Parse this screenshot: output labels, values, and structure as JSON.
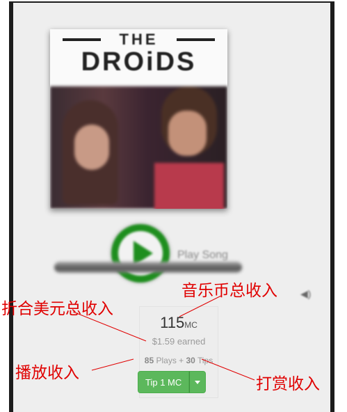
{
  "album": {
    "logo_the": "THE",
    "logo_name": "DROiDS"
  },
  "player": {
    "play_label": "Play Song"
  },
  "stats": {
    "coins": "115",
    "coins_unit": "MC",
    "earned": "$1.59 earned",
    "plays_count": "85",
    "plays_label": " Plays + ",
    "tips_count": "30",
    "tips_label": " Tips"
  },
  "tip": {
    "button_label": "Tip 1 MC"
  },
  "annotations": {
    "coins_total": "音乐币总收入",
    "usd_total": "折合美元总收入",
    "play_income": "播放收入",
    "tip_income": "打赏收入"
  },
  "colors": {
    "annotation": "#e00000",
    "tip_button": "#5cb85c",
    "play_button": "#1e8e1e"
  },
  "icons": [
    "play-icon",
    "volume-icon",
    "caret-down-icon"
  ]
}
